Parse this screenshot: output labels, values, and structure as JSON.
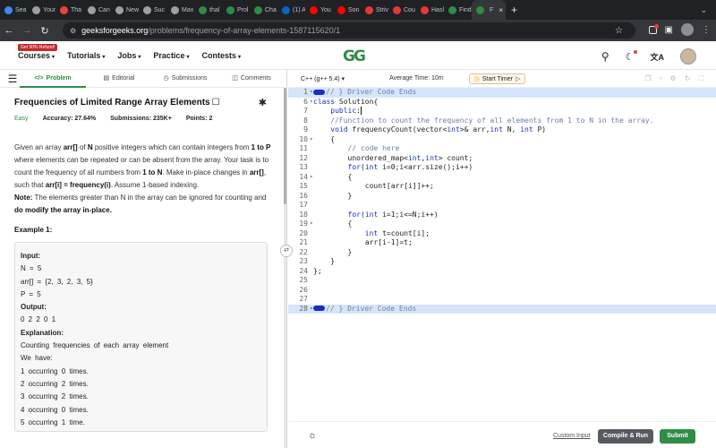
{
  "browser": {
    "tabs": [
      {
        "label": "Sea",
        "icon": "google-icon",
        "color": "#4285f4"
      },
      {
        "label": "Your",
        "icon": "globe-icon",
        "color": "#9aa0a6"
      },
      {
        "label": "Tha",
        "icon": "gmail-icon",
        "color": "#ea4335"
      },
      {
        "label": "Can",
        "icon": "globe-icon",
        "color": "#9aa0a6"
      },
      {
        "label": "New",
        "icon": "globe-icon",
        "color": "#9aa0a6"
      },
      {
        "label": "Suc",
        "icon": "globe-icon",
        "color": "#9aa0a6"
      },
      {
        "label": "Max",
        "icon": "globe-icon",
        "color": "#9aa0a6"
      },
      {
        "label": "thal",
        "icon": "gfg-icon",
        "color": "#2f8d46"
      },
      {
        "label": "Prol",
        "icon": "gfg-icon",
        "color": "#2f8d46"
      },
      {
        "label": "Cha",
        "icon": "gfg-icon",
        "color": "#2f8d46"
      },
      {
        "label": "(1) A",
        "icon": "linkedin-icon",
        "color": "#0a66c2"
      },
      {
        "label": "You",
        "icon": "youtube-icon",
        "color": "#ff0000"
      },
      {
        "label": "Son",
        "icon": "youtube-icon",
        "color": "#ff0000"
      },
      {
        "label": "Striv",
        "icon": "red-circle-icon",
        "color": "#e53935"
      },
      {
        "label": "Cou",
        "icon": "red-circle-icon",
        "color": "#e53935"
      },
      {
        "label": "Hasl",
        "icon": "red-circle-icon",
        "color": "#e53935"
      },
      {
        "label": "Find",
        "icon": "gfg-icon",
        "color": "#2f8d46"
      },
      {
        "label": "F",
        "icon": "gfg-icon",
        "color": "#2f8d46",
        "active": true
      }
    ],
    "new_tab": "+",
    "url_host": "geeksforgeeks.org",
    "url_path": "/problems/frequency-of-array-elements-1587115620/1"
  },
  "site": {
    "badge": "Get 90% Refund!",
    "menu": [
      "Courses",
      "Tutorials",
      "Jobs",
      "Practice",
      "Contests"
    ],
    "logo": "GG"
  },
  "problem": {
    "tabs": [
      {
        "label": "Problem",
        "icon": "code-icon"
      },
      {
        "label": "Editorial",
        "icon": "document-icon"
      },
      {
        "label": "Submissions",
        "icon": "clock-icon"
      },
      {
        "label": "Comments",
        "icon": "comment-icon"
      }
    ],
    "title": "Frequencies of Limited Range Array Elements",
    "difficulty": "Easy",
    "accuracy_label": "Accuracy:",
    "accuracy": "27.64%",
    "submissions_label": "Submissions:",
    "submissions": "235K+",
    "points_label": "Points:",
    "points": "2",
    "example_title": "Example 1:",
    "example_lines": [
      {
        "text": "Input:",
        "bold": true
      },
      {
        "text": "N = 5"
      },
      {
        "text": "arr[] = {2, 3, 2, 3, 5}"
      },
      {
        "text": "P = 5"
      },
      {
        "text": "Output:",
        "bold": true
      },
      {
        "text": "0 2 2 0 1"
      },
      {
        "text": "Explanation:",
        "bold": true
      },
      {
        "text": "Counting frequencies of each array element"
      },
      {
        "text": "We have:"
      },
      {
        "text": "1 occurring 0 times."
      },
      {
        "text": "2 occurring 2 times."
      },
      {
        "text": "3 occurring 2 times."
      },
      {
        "text": "4 occurring 0 times."
      },
      {
        "text": "5 occurring 1 time."
      }
    ]
  },
  "editor": {
    "language": "C++ (g++ 5.4)",
    "avg_time": "Average Time: 10m",
    "timer": "Start Timer",
    "lines": [
      {
        "n": "1",
        "fold": true,
        "hl": true,
        "html": "<span class='fold-marker'></span><span class='cmt'>// } Driver Code Ends</span>"
      },
      {
        "n": "6",
        "fold": true,
        "html": "<span class='kw'>class</span> Solution{"
      },
      {
        "n": "7",
        "html": "    <span class='kw'>public</span>:<span class='caret'></span>"
      },
      {
        "n": "8",
        "html": "    <span class='cmt'>//Function to count the frequency of all elements from 1 to N in the array.</span>"
      },
      {
        "n": "9",
        "html": "    <span class='kw'>void</span> frequencyCount(vector&lt;<span class='kw'>int</span>&gt;&amp; arr,<span class='kw'>int</span> N, <span class='kw'>int</span> P)"
      },
      {
        "n": "10",
        "fold": true,
        "html": "    {"
      },
      {
        "n": "11",
        "html": "        <span class='cmt'>// code here</span>"
      },
      {
        "n": "12",
        "html": "        unordered_map&lt;<span class='kw'>int</span>,<span class='kw'>int</span>&gt; count;"
      },
      {
        "n": "13",
        "html": "        <span class='kw'>for</span>(<span class='kw'>int</span> i=0;i&lt;arr.size();i++)"
      },
      {
        "n": "14",
        "fold": true,
        "html": "        {"
      },
      {
        "n": "15",
        "html": "            count[arr[i]]++;"
      },
      {
        "n": "16",
        "html": "        }"
      },
      {
        "n": "17",
        "html": ""
      },
      {
        "n": "18",
        "html": "        <span class='kw'>for</span>(<span class='kw'>int</span> i=1;i&lt;=N;i++)"
      },
      {
        "n": "19",
        "fold": true,
        "html": "        {"
      },
      {
        "n": "20",
        "html": "            <span class='kw'>int</span> t=count[i];"
      },
      {
        "n": "21",
        "html": "            arr[i-1]=t;"
      },
      {
        "n": "22",
        "html": "        }"
      },
      {
        "n": "23",
        "html": "    }"
      },
      {
        "n": "24",
        "html": "};"
      },
      {
        "n": "25",
        "html": ""
      },
      {
        "n": "26",
        "html": ""
      },
      {
        "n": "27",
        "html": ""
      },
      {
        "n": "28",
        "fold": true,
        "hl": true,
        "html": "<span class='fold-marker'></span><span class='cmt'>// } Driver Code Ends</span>"
      }
    ]
  },
  "footer": {
    "custom_input": "Custom Input",
    "compile_run": "Compile & Run",
    "submit": "Submit"
  },
  "colors": {
    "brand_green": "#2f8d46",
    "highlight_blue": "#d5e5fb"
  }
}
